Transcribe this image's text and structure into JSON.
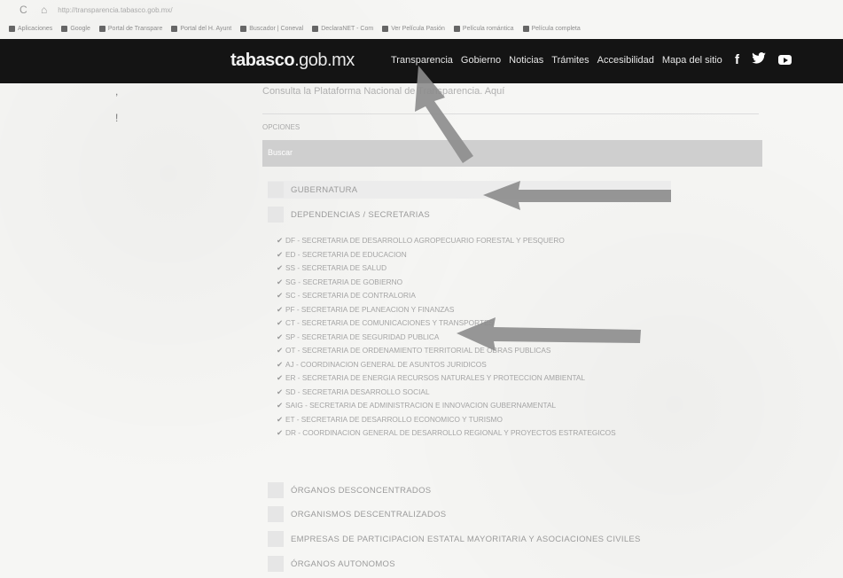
{
  "browser": {
    "nav_icons": "C ⌂",
    "url": "http://transparencia.tabasco.gob.mx/",
    "bookmarks": [
      "Aplicaciones",
      "Google",
      "Portal de Transpare",
      "Portal del H. Ayunt",
      "Buscador | Coneval",
      "DeclaraNET - Com",
      "Ver Película Pasión",
      "Película romántica",
      "Película completa"
    ]
  },
  "header": {
    "logo_main": "tabasco",
    "logo_domain": ".gob.mx",
    "menu": [
      "Transparencia",
      "Gobierno",
      "Noticias",
      "Trámites",
      "Accesibilidad",
      "Mapa del sitio"
    ],
    "social": {
      "facebook": "f",
      "twitter": "🐦"
    },
    "bg_color": "#141414"
  },
  "content": {
    "subtitle": "Consulta la Plataforma Nacional de Transparencia. Aquí",
    "small_label": "OPCIONES",
    "search_text": "Buscar",
    "sections_top": [
      {
        "label": "GUBERNATURA"
      },
      {
        "label": "DEPENDENCIAS / SECRETARIAS"
      }
    ],
    "items": [
      "DF - SECRETARIA DE DESARROLLO AGROPECUARIO FORESTAL Y PESQUERO",
      "ED - SECRETARIA DE EDUCACION",
      "SS - SECRETARIA DE SALUD",
      "SG - SECRETARIA DE GOBIERNO",
      "SC - SECRETARIA DE CONTRALORIA",
      "PF - SECRETARIA DE PLANEACION Y FINANZAS",
      "CT - SECRETARIA DE COMUNICACIONES Y TRANSPORTES",
      "SP - SECRETARIA DE SEGURIDAD PUBLICA",
      "OT - SECRETARIA DE ORDENAMIENTO TERRITORIAL DE OBRAS PUBLICAS",
      "AJ - COORDINACION GENERAL DE ASUNTOS JURIDICOS",
      "ER - SECRETARIA DE ENERGIA RECURSOS NATURALES Y PROTECCION AMBIENTAL",
      "SD - SECRETARIA DESARROLLO SOCIAL",
      "SAIG - SECRETARIA DE ADMINISTRACION E INNOVACION GUBERNAMENTAL",
      "ET - SECRETARIA DE DESARROLLO ECONOMICO Y TURISMO",
      "DR - COORDINACION GENERAL DE DESARROLLO REGIONAL Y PROYECTOS ESTRATEGICOS"
    ],
    "sections_bottom": [
      {
        "label": "ÓRGANOS DESCONCENTRADOS"
      },
      {
        "label": "ORGANISMOS DESCENTRALIZADOS"
      },
      {
        "label": "EMPRESAS DE PARTICIPACION ESTATAL MAYORITARIA Y ASOCIACIONES CIVILES"
      },
      {
        "label": "ÓRGANOS AUTONOMOS"
      }
    ],
    "check_glyph": "✔"
  },
  "annotations": {
    "arrow_color": "#8c8c8c"
  }
}
